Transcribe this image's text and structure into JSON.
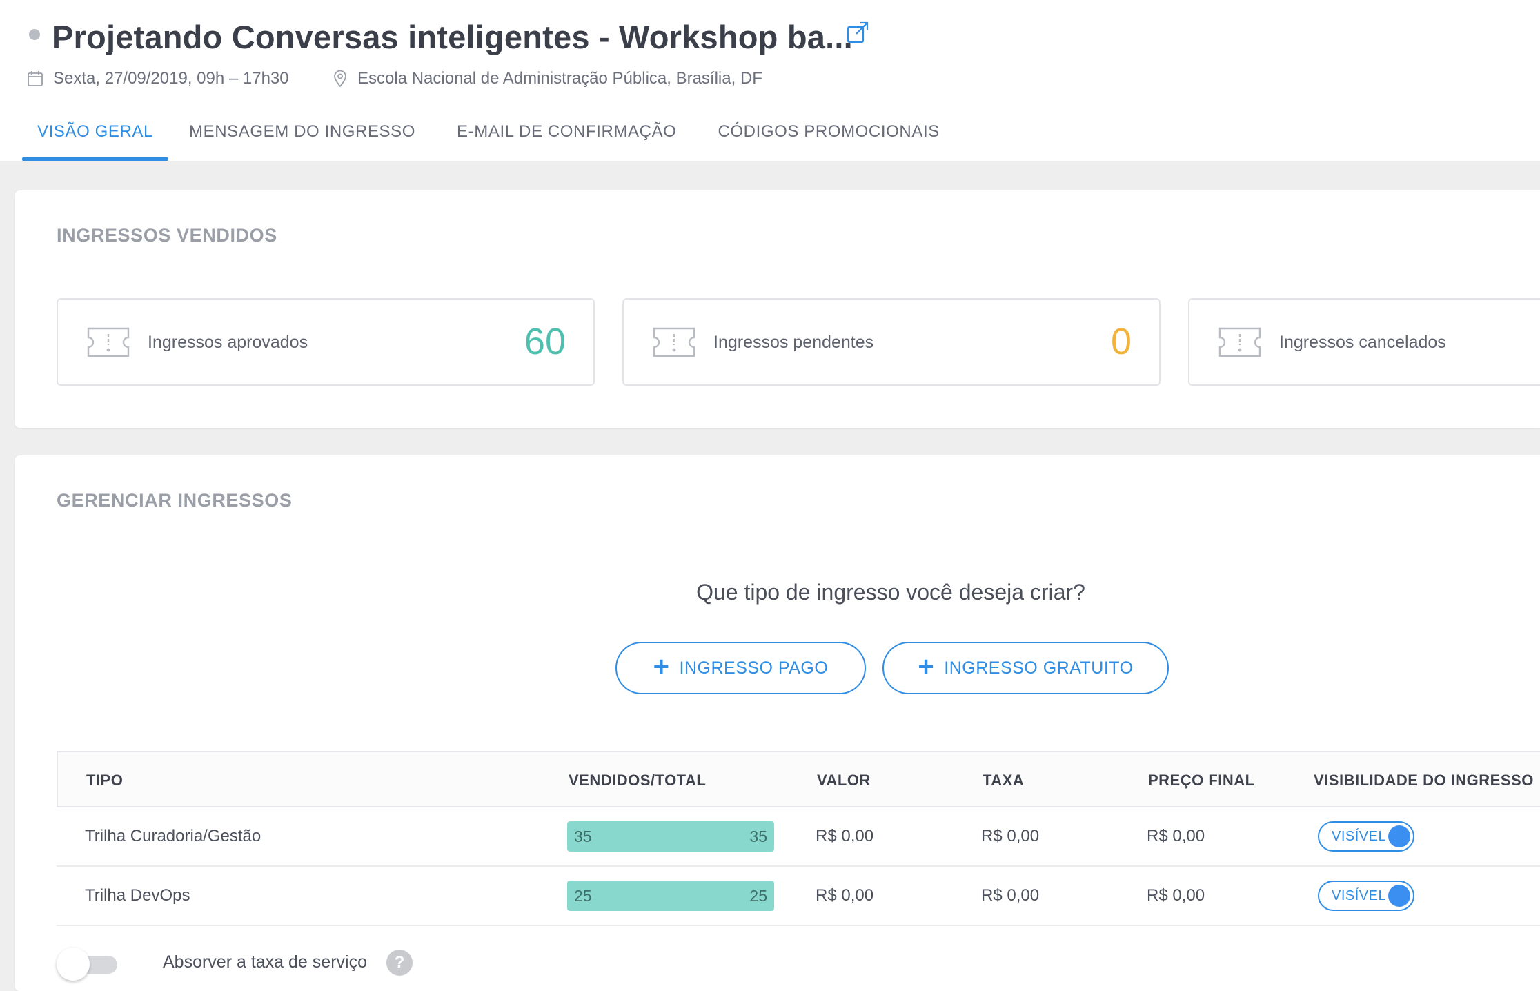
{
  "event": {
    "title": "Projetando Conversas inteligentes - Workshop ba...",
    "date": "Sexta, 27/09/2019, 09h – 17h30",
    "location": "Escola Nacional de Administração Pública, Brasília, DF"
  },
  "tabs": [
    {
      "label": "VISÃO GERAL",
      "active": true
    },
    {
      "label": "MENSAGEM DO INGRESSO",
      "active": false
    },
    {
      "label": "E-MAIL DE CONFIRMAÇÃO",
      "active": false
    },
    {
      "label": "CÓDIGOS PROMOCIONAIS",
      "active": false
    }
  ],
  "sold": {
    "title": "INGRESSOS VENDIDOS",
    "stats": [
      {
        "label": "Ingressos aprovados",
        "value": "60",
        "color": "#4fc0b0"
      },
      {
        "label": "Ingressos pendentes",
        "value": "0",
        "color": "#f2b33d"
      },
      {
        "label": "Ingressos cancelados",
        "value": ""
      }
    ]
  },
  "manage": {
    "title": "GERENCIAR INGRESSOS",
    "question": "Que tipo de ingresso você deseja criar?",
    "paid_button": "INGRESSO PAGO",
    "free_button": "INGRESSO GRATUITO",
    "columns": {
      "tipo": "TIPO",
      "vendidos": "VENDIDOS/TOTAL",
      "valor": "VALOR",
      "taxa": "TAXA",
      "preco": "PREÇO FINAL",
      "visibilidade": "VISIBILIDADE DO INGRESSO"
    },
    "rows": [
      {
        "tipo": "Trilha Curadoria/Gestão",
        "sold": "35",
        "total": "35",
        "valor": "R$ 0,00",
        "taxa": "R$ 0,00",
        "preco": "R$ 0,00",
        "visibility": "VISÍVEL"
      },
      {
        "tipo": "Trilha DevOps",
        "sold": "25",
        "total": "25",
        "valor": "R$ 0,00",
        "taxa": "R$ 0,00",
        "preco": "R$ 0,00",
        "visibility": "VISÍVEL"
      }
    ],
    "fee_label": "Absorver a taxa de serviço",
    "help_symbol": "?"
  },
  "colors": {
    "accent": "#2f8de4",
    "approved": "#4fc0b0",
    "pending": "#f2b33d",
    "progress": "#88d8ce"
  },
  "icons": [
    "calendar-icon",
    "location-pin-icon",
    "external-link-icon",
    "ticket-icon",
    "plus-icon",
    "help-icon"
  ]
}
